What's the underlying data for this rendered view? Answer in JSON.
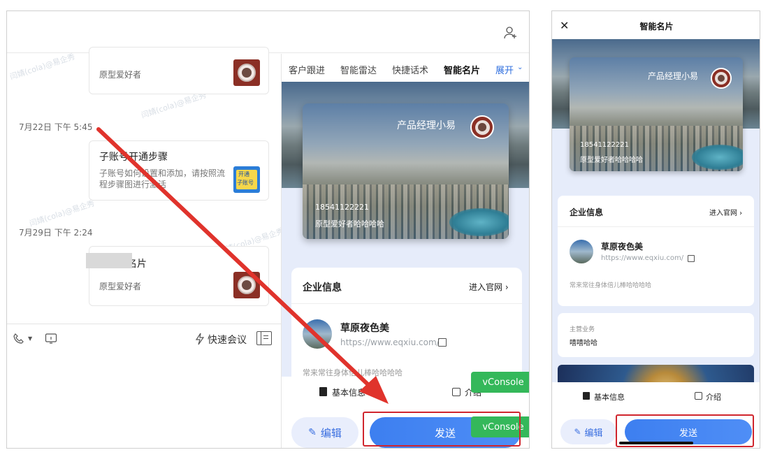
{
  "left": {
    "messages": [
      {
        "time": "",
        "title": "",
        "desc": "原型爱好者"
      },
      {
        "time": "7月22日 下午 5:45",
        "title": "子账号开通步骤",
        "desc": "子账号如何设置和添加，请按照流程步骤图进行激活",
        "badge_line1": "开通",
        "badge_line2": "子账号"
      },
      {
        "time": "7月29日 下午 2:24",
        "title": "名片",
        "desc": "原型爱好者"
      }
    ],
    "watermarks": [
      "闫婧(cola)@易企秀",
      "闫婧(cola)@易企秀",
      "闫婧(cola)@易企秀",
      "闫婧(cola)@易企秀 4159"
    ],
    "toolbar": {
      "meeting": "快速会议"
    }
  },
  "middle": {
    "tabs": [
      "客户跟进",
      "智能雷达",
      "快捷话术",
      "智能名片",
      "展开"
    ],
    "card": {
      "name": "产品经理小易",
      "phone": "18541122221",
      "sign": "原型爱好者哈哈哈哈"
    },
    "company": {
      "section": "企业信息",
      "official": "进入官网",
      "name": "草原夜色美",
      "url": "https://www.eqxiu.com/",
      "desc": "常来常往身体倍儿棒哈哈哈哈"
    },
    "bottom_tabs": [
      "基本信息",
      "介绍"
    ],
    "edit": "编辑",
    "send": "发送",
    "vconsole": "vConsole"
  },
  "right": {
    "title": "智能名片",
    "card": {
      "name": "产品经理小易",
      "phone": "18541122221",
      "sign": "原型爱好者哈哈哈哈"
    },
    "company": {
      "section": "企业信息",
      "official": "进入官网",
      "name": "草原夜色美",
      "url": "https://www.eqxiu.com/",
      "desc": "常来常往身体倍儿棒哈哈哈哈"
    },
    "business": {
      "label": "主营业务",
      "value": "嘻嘻哈哈"
    },
    "bottom_tabs": [
      "基本信息",
      "介绍"
    ],
    "edit": "编辑",
    "send": "发送"
  },
  "colors": {
    "accent": "#3d7ff0",
    "highlight": "#d0262e",
    "vconsole": "#34b85a"
  }
}
